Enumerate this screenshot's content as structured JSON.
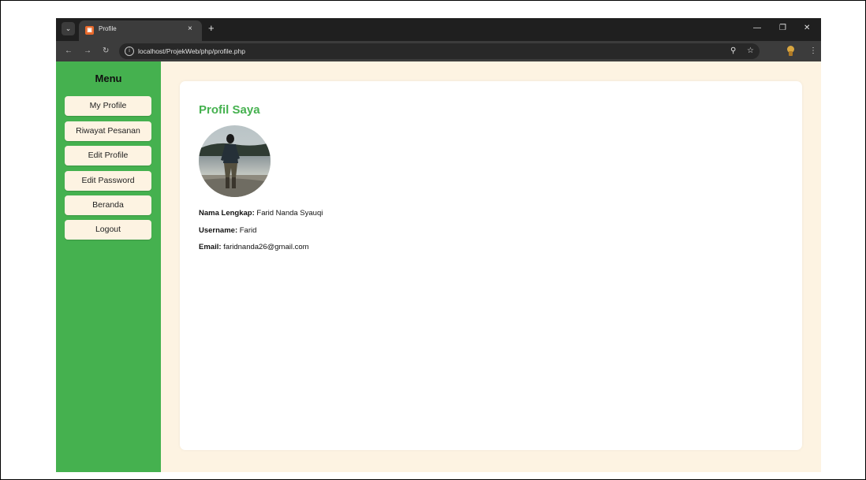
{
  "browser": {
    "tab_title": "Profile",
    "tab_close": "×",
    "new_tab": "+",
    "url": "localhost/ProjekWeb/php/profile.php",
    "icons": [
      "tab-menu-icon",
      "favicon-icon",
      "back-icon",
      "forward-icon",
      "reload-icon",
      "info-icon",
      "zoom-icon",
      "star-icon",
      "extension-icon",
      "more-icon",
      "minimize-icon",
      "restore-icon",
      "close-icon"
    ]
  },
  "sidebar": {
    "title": "Menu",
    "items": [
      {
        "label": "My Profile"
      },
      {
        "label": "Riwayat Pesanan"
      },
      {
        "label": "Edit Profile"
      },
      {
        "label": "Edit Password"
      },
      {
        "label": "Beranda"
      },
      {
        "label": "Logout"
      }
    ]
  },
  "profile": {
    "title": "Profil Saya",
    "fields": [
      {
        "label": "Nama Lengkap:",
        "value": "Farid Nanda Syauqi"
      },
      {
        "label": "Username:",
        "value": "Farid"
      },
      {
        "label": "Email:",
        "value": "faridnanda26@gmail.com"
      }
    ]
  },
  "colors": {
    "sidebar_green": "#45b14f",
    "page_background": "#fdf3e2",
    "title_green": "#45b14f",
    "browser_dark": "#1f1f1f"
  }
}
